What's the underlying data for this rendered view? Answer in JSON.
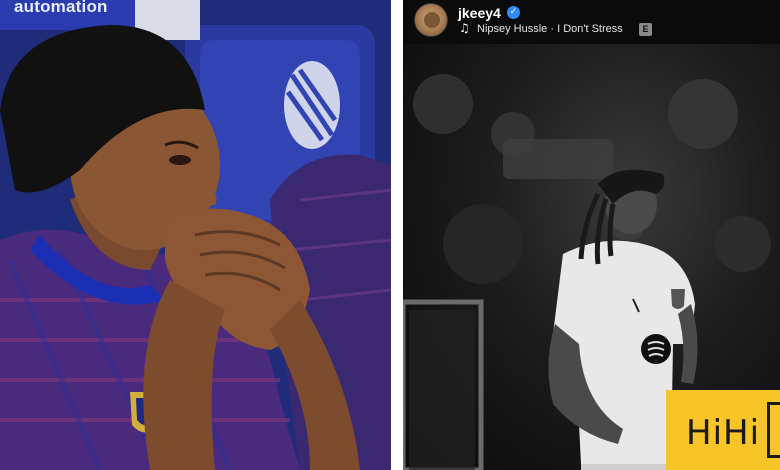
{
  "left_photo": {
    "banner_text": "automation"
  },
  "post": {
    "username": "jkeey4",
    "verified_icon": "verified-badge-icon",
    "music_icon": "music-note-icon",
    "song": "Nipsey Hussle · I Don't Stress",
    "explicit_badge": "E"
  },
  "watermark": {
    "text": "HiHi"
  },
  "colors": {
    "kit_blue": "#23308a",
    "kit_purple": "#5a2a6e",
    "verified_blue": "#2f8cf3",
    "watermark_yellow": "#f7c528"
  }
}
